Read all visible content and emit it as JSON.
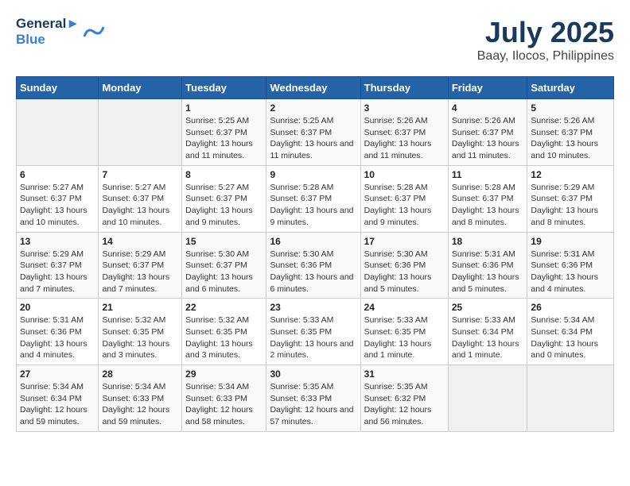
{
  "header": {
    "logo_line1": "General",
    "logo_line2": "Blue",
    "title": "July 2025",
    "subtitle": "Baay, Ilocos, Philippines"
  },
  "days_of_week": [
    "Sunday",
    "Monday",
    "Tuesday",
    "Wednesday",
    "Thursday",
    "Friday",
    "Saturday"
  ],
  "weeks": [
    [
      {
        "day": "",
        "info": ""
      },
      {
        "day": "",
        "info": ""
      },
      {
        "day": "1",
        "info": "Sunrise: 5:25 AM\nSunset: 6:37 PM\nDaylight: 13 hours and 11 minutes."
      },
      {
        "day": "2",
        "info": "Sunrise: 5:25 AM\nSunset: 6:37 PM\nDaylight: 13 hours and 11 minutes."
      },
      {
        "day": "3",
        "info": "Sunrise: 5:26 AM\nSunset: 6:37 PM\nDaylight: 13 hours and 11 minutes."
      },
      {
        "day": "4",
        "info": "Sunrise: 5:26 AM\nSunset: 6:37 PM\nDaylight: 13 hours and 11 minutes."
      },
      {
        "day": "5",
        "info": "Sunrise: 5:26 AM\nSunset: 6:37 PM\nDaylight: 13 hours and 10 minutes."
      }
    ],
    [
      {
        "day": "6",
        "info": "Sunrise: 5:27 AM\nSunset: 6:37 PM\nDaylight: 13 hours and 10 minutes."
      },
      {
        "day": "7",
        "info": "Sunrise: 5:27 AM\nSunset: 6:37 PM\nDaylight: 13 hours and 10 minutes."
      },
      {
        "day": "8",
        "info": "Sunrise: 5:27 AM\nSunset: 6:37 PM\nDaylight: 13 hours and 9 minutes."
      },
      {
        "day": "9",
        "info": "Sunrise: 5:28 AM\nSunset: 6:37 PM\nDaylight: 13 hours and 9 minutes."
      },
      {
        "day": "10",
        "info": "Sunrise: 5:28 AM\nSunset: 6:37 PM\nDaylight: 13 hours and 9 minutes."
      },
      {
        "day": "11",
        "info": "Sunrise: 5:28 AM\nSunset: 6:37 PM\nDaylight: 13 hours and 8 minutes."
      },
      {
        "day": "12",
        "info": "Sunrise: 5:29 AM\nSunset: 6:37 PM\nDaylight: 13 hours and 8 minutes."
      }
    ],
    [
      {
        "day": "13",
        "info": "Sunrise: 5:29 AM\nSunset: 6:37 PM\nDaylight: 13 hours and 7 minutes."
      },
      {
        "day": "14",
        "info": "Sunrise: 5:29 AM\nSunset: 6:37 PM\nDaylight: 13 hours and 7 minutes."
      },
      {
        "day": "15",
        "info": "Sunrise: 5:30 AM\nSunset: 6:37 PM\nDaylight: 13 hours and 6 minutes."
      },
      {
        "day": "16",
        "info": "Sunrise: 5:30 AM\nSunset: 6:36 PM\nDaylight: 13 hours and 6 minutes."
      },
      {
        "day": "17",
        "info": "Sunrise: 5:30 AM\nSunset: 6:36 PM\nDaylight: 13 hours and 5 minutes."
      },
      {
        "day": "18",
        "info": "Sunrise: 5:31 AM\nSunset: 6:36 PM\nDaylight: 13 hours and 5 minutes."
      },
      {
        "day": "19",
        "info": "Sunrise: 5:31 AM\nSunset: 6:36 PM\nDaylight: 13 hours and 4 minutes."
      }
    ],
    [
      {
        "day": "20",
        "info": "Sunrise: 5:31 AM\nSunset: 6:36 PM\nDaylight: 13 hours and 4 minutes."
      },
      {
        "day": "21",
        "info": "Sunrise: 5:32 AM\nSunset: 6:35 PM\nDaylight: 13 hours and 3 minutes."
      },
      {
        "day": "22",
        "info": "Sunrise: 5:32 AM\nSunset: 6:35 PM\nDaylight: 13 hours and 3 minutes."
      },
      {
        "day": "23",
        "info": "Sunrise: 5:33 AM\nSunset: 6:35 PM\nDaylight: 13 hours and 2 minutes."
      },
      {
        "day": "24",
        "info": "Sunrise: 5:33 AM\nSunset: 6:35 PM\nDaylight: 13 hours and 1 minute."
      },
      {
        "day": "25",
        "info": "Sunrise: 5:33 AM\nSunset: 6:34 PM\nDaylight: 13 hours and 1 minute."
      },
      {
        "day": "26",
        "info": "Sunrise: 5:34 AM\nSunset: 6:34 PM\nDaylight: 13 hours and 0 minutes."
      }
    ],
    [
      {
        "day": "27",
        "info": "Sunrise: 5:34 AM\nSunset: 6:34 PM\nDaylight: 12 hours and 59 minutes."
      },
      {
        "day": "28",
        "info": "Sunrise: 5:34 AM\nSunset: 6:33 PM\nDaylight: 12 hours and 59 minutes."
      },
      {
        "day": "29",
        "info": "Sunrise: 5:34 AM\nSunset: 6:33 PM\nDaylight: 12 hours and 58 minutes."
      },
      {
        "day": "30",
        "info": "Sunrise: 5:35 AM\nSunset: 6:33 PM\nDaylight: 12 hours and 57 minutes."
      },
      {
        "day": "31",
        "info": "Sunrise: 5:35 AM\nSunset: 6:32 PM\nDaylight: 12 hours and 56 minutes."
      },
      {
        "day": "",
        "info": ""
      },
      {
        "day": "",
        "info": ""
      }
    ]
  ]
}
